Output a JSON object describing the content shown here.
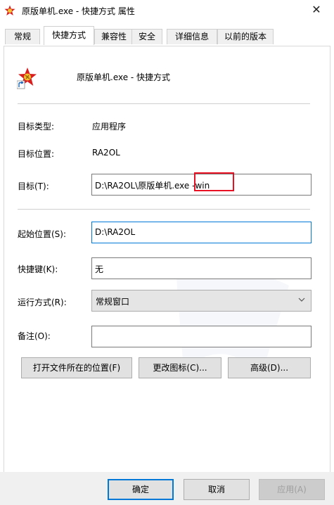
{
  "window": {
    "title": "原版单机.exe - 快捷方式 属性",
    "close_glyph": "✕"
  },
  "tabs": [
    {
      "label": "常规"
    },
    {
      "label": "快捷方式",
      "active": true
    },
    {
      "label": "兼容性"
    },
    {
      "label": "安全"
    },
    {
      "label": "详细信息"
    },
    {
      "label": "以前的版本"
    }
  ],
  "header": {
    "name": "原版单机.exe - 快捷方式"
  },
  "properties": {
    "target_type_label": "目标类型:",
    "target_type_value": "应用程序",
    "target_location_label": "目标位置:",
    "target_location_value": "RA2OL",
    "target_label": "目标(T):",
    "target_value": "D:\\RA2OL\\原版单机.exe -win",
    "start_in_label": "起始位置(S):",
    "start_in_value": "D:\\RA2OL",
    "hotkey_label": "快捷键(K):",
    "hotkey_value": "无",
    "run_label": "运行方式(R):",
    "run_value": "常规窗口",
    "comment_label": "备注(O):",
    "comment_value": ""
  },
  "buttons": {
    "open_location": "打开文件所在的位置(F)",
    "change_icon": "更改图标(C)...",
    "advanced": "高级(D)..."
  },
  "footer": {
    "ok": "确定",
    "cancel": "取消",
    "apply": "应用(A)"
  },
  "colors": {
    "accent": "#0078d7",
    "highlight_box": "#e81123"
  },
  "icons": {
    "app": "soviet-emblem-icon",
    "shortcut": "shortcut-arrow-icon",
    "dropdown": "chevron-down-icon"
  }
}
